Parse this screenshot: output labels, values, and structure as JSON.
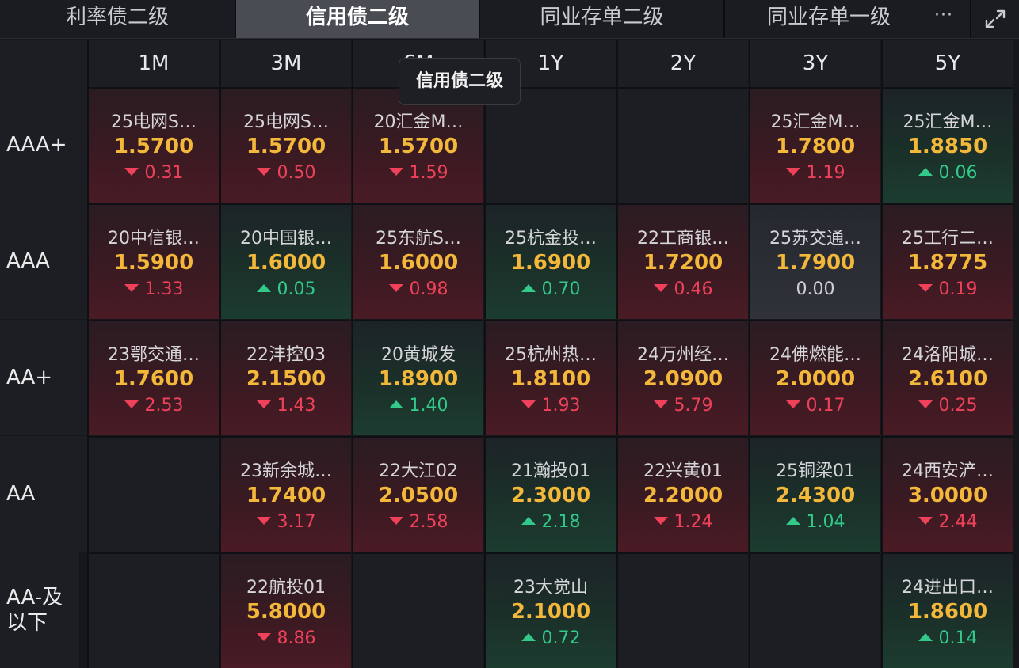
{
  "tabs": [
    {
      "label": "利率债二级",
      "active": false
    },
    {
      "label": "信用债二级",
      "active": true
    },
    {
      "label": "同业存单二级",
      "active": false
    },
    {
      "label": "同业存单一级",
      "active": false
    }
  ],
  "more_label": "···",
  "tooltip": "信用债二级",
  "columns": [
    "1M",
    "3M",
    "6M",
    "1Y",
    "2Y",
    "3Y",
    "5Y"
  ],
  "rows": [
    {
      "label": "AAA+",
      "cells": [
        {
          "name": "25电网S…",
          "yield": "1.5700",
          "dir": "down",
          "change": "0.31"
        },
        {
          "name": "25电网S…",
          "yield": "1.5700",
          "dir": "down",
          "change": "0.50"
        },
        {
          "name": "20汇金M…",
          "yield": "1.5700",
          "dir": "down",
          "change": "1.59"
        },
        null,
        null,
        {
          "name": "25汇金M…",
          "yield": "1.7800",
          "dir": "down",
          "change": "1.19"
        },
        {
          "name": "25汇金M…",
          "yield": "1.8850",
          "dir": "up",
          "change": "0.06"
        }
      ]
    },
    {
      "label": "AAA",
      "cells": [
        {
          "name": "20中信银…",
          "yield": "1.5900",
          "dir": "down",
          "change": "1.33"
        },
        {
          "name": "20中国银…",
          "yield": "1.6000",
          "dir": "up",
          "change": "0.05"
        },
        {
          "name": "25东航S…",
          "yield": "1.6000",
          "dir": "down",
          "change": "0.98"
        },
        {
          "name": "25杭金投…",
          "yield": "1.6900",
          "dir": "up",
          "change": "0.70"
        },
        {
          "name": "22工商银…",
          "yield": "1.7200",
          "dir": "down",
          "change": "0.46"
        },
        {
          "name": "25苏交通…",
          "yield": "1.7900",
          "dir": "flat",
          "change": "0.00"
        },
        {
          "name": "25工行二…",
          "yield": "1.8775",
          "dir": "down",
          "change": "0.19"
        }
      ]
    },
    {
      "label": "AA+",
      "cells": [
        {
          "name": "23鄂交通…",
          "yield": "1.7600",
          "dir": "down",
          "change": "2.53"
        },
        {
          "name": "22沣控03",
          "yield": "2.1500",
          "dir": "down",
          "change": "1.43"
        },
        {
          "name": "20黄城发",
          "yield": "1.8900",
          "dir": "up",
          "change": "1.40"
        },
        {
          "name": "25杭州热…",
          "yield": "1.8100",
          "dir": "down",
          "change": "1.93"
        },
        {
          "name": "24万州经…",
          "yield": "2.0900",
          "dir": "down",
          "change": "5.79"
        },
        {
          "name": "24佛燃能…",
          "yield": "2.0000",
          "dir": "down",
          "change": "0.17"
        },
        {
          "name": "24洛阳城…",
          "yield": "2.6100",
          "dir": "down",
          "change": "0.25"
        }
      ]
    },
    {
      "label": "AA",
      "cells": [
        null,
        {
          "name": "23新余城…",
          "yield": "1.7400",
          "dir": "down",
          "change": "3.17"
        },
        {
          "name": "22大江02",
          "yield": "2.0500",
          "dir": "down",
          "change": "2.58"
        },
        {
          "name": "21瀚投01",
          "yield": "2.3000",
          "dir": "up",
          "change": "2.18"
        },
        {
          "name": "22兴黄01",
          "yield": "2.2000",
          "dir": "down",
          "change": "1.24"
        },
        {
          "name": "25铜梁01",
          "yield": "2.4300",
          "dir": "up",
          "change": "1.04"
        },
        {
          "name": "24西安浐…",
          "yield": "3.0000",
          "dir": "down",
          "change": "2.44"
        }
      ]
    },
    {
      "label": "AA-及以下",
      "cells": [
        null,
        {
          "name": "22航投01",
          "yield": "5.8000",
          "dir": "down",
          "change": "8.86"
        },
        null,
        {
          "name": "23大觉山",
          "yield": "2.1000",
          "dir": "up",
          "change": "0.72"
        },
        null,
        null,
        {
          "name": "24进出口…",
          "yield": "1.8600",
          "dir": "up",
          "change": "0.14"
        }
      ]
    }
  ]
}
